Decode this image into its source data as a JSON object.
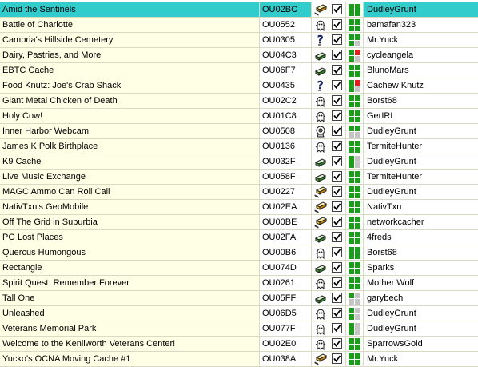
{
  "colors": {
    "selected": "#33cccc",
    "name_bg": "#ffffe6",
    "green": "#1e9b1e",
    "red": "#e02020",
    "grey": "#c4c4c4"
  },
  "rows": [
    {
      "name": "Amid the Sentinels",
      "code": "OU02BC",
      "type_icon": "multi-cache-icon",
      "found": true,
      "status": [
        "g",
        "g",
        "g",
        "g"
      ],
      "owner": "DudleyGrunt",
      "selected": true
    },
    {
      "name": "Battle of Charlotte",
      "code": "OU0552",
      "type_icon": "virtual-cache-icon",
      "found": true,
      "status": [
        "g",
        "g",
        "g",
        "g"
      ],
      "owner": "bamafan323"
    },
    {
      "name": "Cambria's Hillside Cemetery",
      "code": "OU0305",
      "type_icon": "mystery-cache-icon",
      "found": true,
      "status": [
        "g",
        "g",
        "g",
        "x"
      ],
      "owner": "Mr.Yuck"
    },
    {
      "name": "Dairy, Pastries, and More",
      "code": "OU04C3",
      "type_icon": "traditional-cache-icon",
      "found": true,
      "status": [
        "g",
        "r",
        "g",
        "x"
      ],
      "owner": "cycleangela"
    },
    {
      "name": "EBTC Cache",
      "code": "OU06F7",
      "type_icon": "traditional-cache-icon",
      "found": true,
      "status": [
        "g",
        "g",
        "g",
        "g"
      ],
      "owner": "BlunoMars"
    },
    {
      "name": "Food Knutz: Joe's Crab Shack",
      "code": "OU0435",
      "type_icon": "mystery-cache-icon",
      "found": true,
      "status": [
        "g",
        "r",
        "g",
        "x"
      ],
      "owner": "Cachew Knutz"
    },
    {
      "name": "Giant Metal Chicken of Death",
      "code": "OU02C2",
      "type_icon": "virtual-cache-icon",
      "found": true,
      "status": [
        "g",
        "g",
        "g",
        "g"
      ],
      "owner": "Borst68"
    },
    {
      "name": "Holy Cow!",
      "code": "OU01C8",
      "type_icon": "virtual-cache-icon",
      "found": true,
      "status": [
        "g",
        "g",
        "g",
        "g"
      ],
      "owner": "GerIRL"
    },
    {
      "name": "Inner Harbor Webcam",
      "code": "OU0508",
      "type_icon": "webcam-cache-icon",
      "found": true,
      "status": [
        "g",
        "g",
        "x",
        "x"
      ],
      "owner": "DudleyGrunt"
    },
    {
      "name": "James K Polk Birthplace",
      "code": "OU0136",
      "type_icon": "virtual-cache-icon",
      "found": true,
      "status": [
        "g",
        "g",
        "g",
        "g"
      ],
      "owner": "TermiteHunter"
    },
    {
      "name": "K9 Cache",
      "code": "OU032F",
      "type_icon": "traditional-cache-icon",
      "found": true,
      "status": [
        "g",
        "x",
        "g",
        "x"
      ],
      "owner": "DudleyGrunt"
    },
    {
      "name": "Live Music Exchange",
      "code": "OU058F",
      "type_icon": "traditional-cache-icon",
      "found": true,
      "status": [
        "g",
        "g",
        "g",
        "g"
      ],
      "owner": "TermiteHunter"
    },
    {
      "name": "MAGC Ammo Can Roll Call",
      "code": "OU0227",
      "type_icon": "multi-cache-icon",
      "found": true,
      "status": [
        "g",
        "g",
        "g",
        "g"
      ],
      "owner": "DudleyGrunt"
    },
    {
      "name": "NativTxn's GeoMobile",
      "code": "OU02EA",
      "type_icon": "multi-cache-icon",
      "found": true,
      "status": [
        "g",
        "g",
        "g",
        "g"
      ],
      "owner": "NativTxn"
    },
    {
      "name": "Off The Grid in Suburbia",
      "code": "OU00BE",
      "type_icon": "multi-cache-icon",
      "found": true,
      "status": [
        "g",
        "g",
        "g",
        "g"
      ],
      "owner": "networkcacher"
    },
    {
      "name": "PG Lost Places",
      "code": "OU02FA",
      "type_icon": "traditional-cache-icon",
      "found": true,
      "status": [
        "g",
        "g",
        "g",
        "g"
      ],
      "owner": "4freds"
    },
    {
      "name": "Quercus Humongous",
      "code": "OU00B6",
      "type_icon": "virtual-cache-icon",
      "found": true,
      "status": [
        "g",
        "g",
        "g",
        "g"
      ],
      "owner": "Borst68"
    },
    {
      "name": "Rectangle",
      "code": "OU074D",
      "type_icon": "traditional-cache-icon",
      "found": true,
      "status": [
        "g",
        "g",
        "g",
        "g"
      ],
      "owner": "Sparks"
    },
    {
      "name": "Spirit Quest: Remember Forever",
      "code": "OU0261",
      "type_icon": "virtual-cache-icon",
      "found": true,
      "status": [
        "g",
        "g",
        "g",
        "g"
      ],
      "owner": "Mother Wolf"
    },
    {
      "name": "Tall One",
      "code": "OU05FF",
      "type_icon": "traditional-cache-icon",
      "found": true,
      "status": [
        "g",
        "x",
        "x",
        "x"
      ],
      "owner": "garybech"
    },
    {
      "name": "Unleashed",
      "code": "OU06D5",
      "type_icon": "virtual-cache-icon",
      "found": true,
      "status": [
        "g",
        "x",
        "g",
        "x"
      ],
      "owner": "DudleyGrunt"
    },
    {
      "name": "Veterans Memorial Park",
      "code": "OU077F",
      "type_icon": "virtual-cache-icon",
      "found": true,
      "status": [
        "g",
        "x",
        "g",
        "x"
      ],
      "owner": "DudleyGrunt"
    },
    {
      "name": "Welcome to the Kenilworth Veterans Center!",
      "code": "OU02E0",
      "type_icon": "virtual-cache-icon",
      "found": true,
      "status": [
        "g",
        "g",
        "g",
        "g"
      ],
      "owner": "SparrowsGold"
    },
    {
      "name": "Yucko's OCNA Moving Cache #1",
      "code": "OU038A",
      "type_icon": "multi-cache-icon",
      "found": true,
      "status": [
        "g",
        "g",
        "g",
        "g"
      ],
      "owner": "Mr.Yuck"
    }
  ]
}
